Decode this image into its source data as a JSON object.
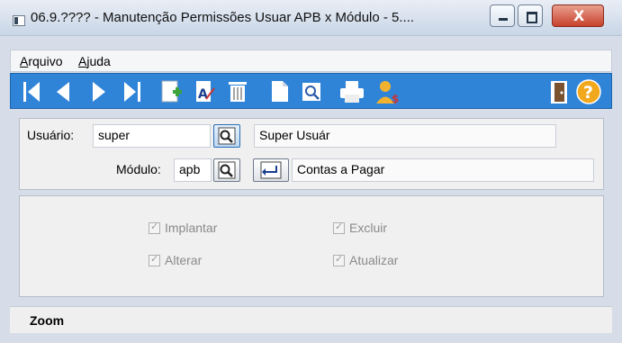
{
  "window": {
    "title": "06.9.???? - Manutenção Permissões Usuar APB x Módulo - 5....",
    "close_glyph": "X"
  },
  "menu": {
    "arquivo_accel": "A",
    "arquivo_rest": "rquivo",
    "ajuda_accel": "A",
    "ajuda_rest": "juda"
  },
  "toolbar": {
    "icons": [
      "first-record-icon",
      "previous-record-icon",
      "next-record-icon",
      "last-record-icon",
      "add-icon",
      "edit-icon",
      "delete-icon",
      "new-document-icon",
      "zoom-icon",
      "print-icon",
      "user-icon",
      "exit-door-icon",
      "help-icon"
    ]
  },
  "form": {
    "usuario_label": "Usuário:",
    "usuario_value": "super",
    "usuario_desc": "Super Usuár",
    "modulo_label": "Módulo:",
    "modulo_value": "apb",
    "modulo_desc": "Contas a Pagar"
  },
  "permissions": {
    "implantar": "Implantar",
    "excluir": "Excluir",
    "alterar": "Alterar",
    "atualizar": "Atualizar"
  },
  "status": {
    "text": "Zoom"
  }
}
